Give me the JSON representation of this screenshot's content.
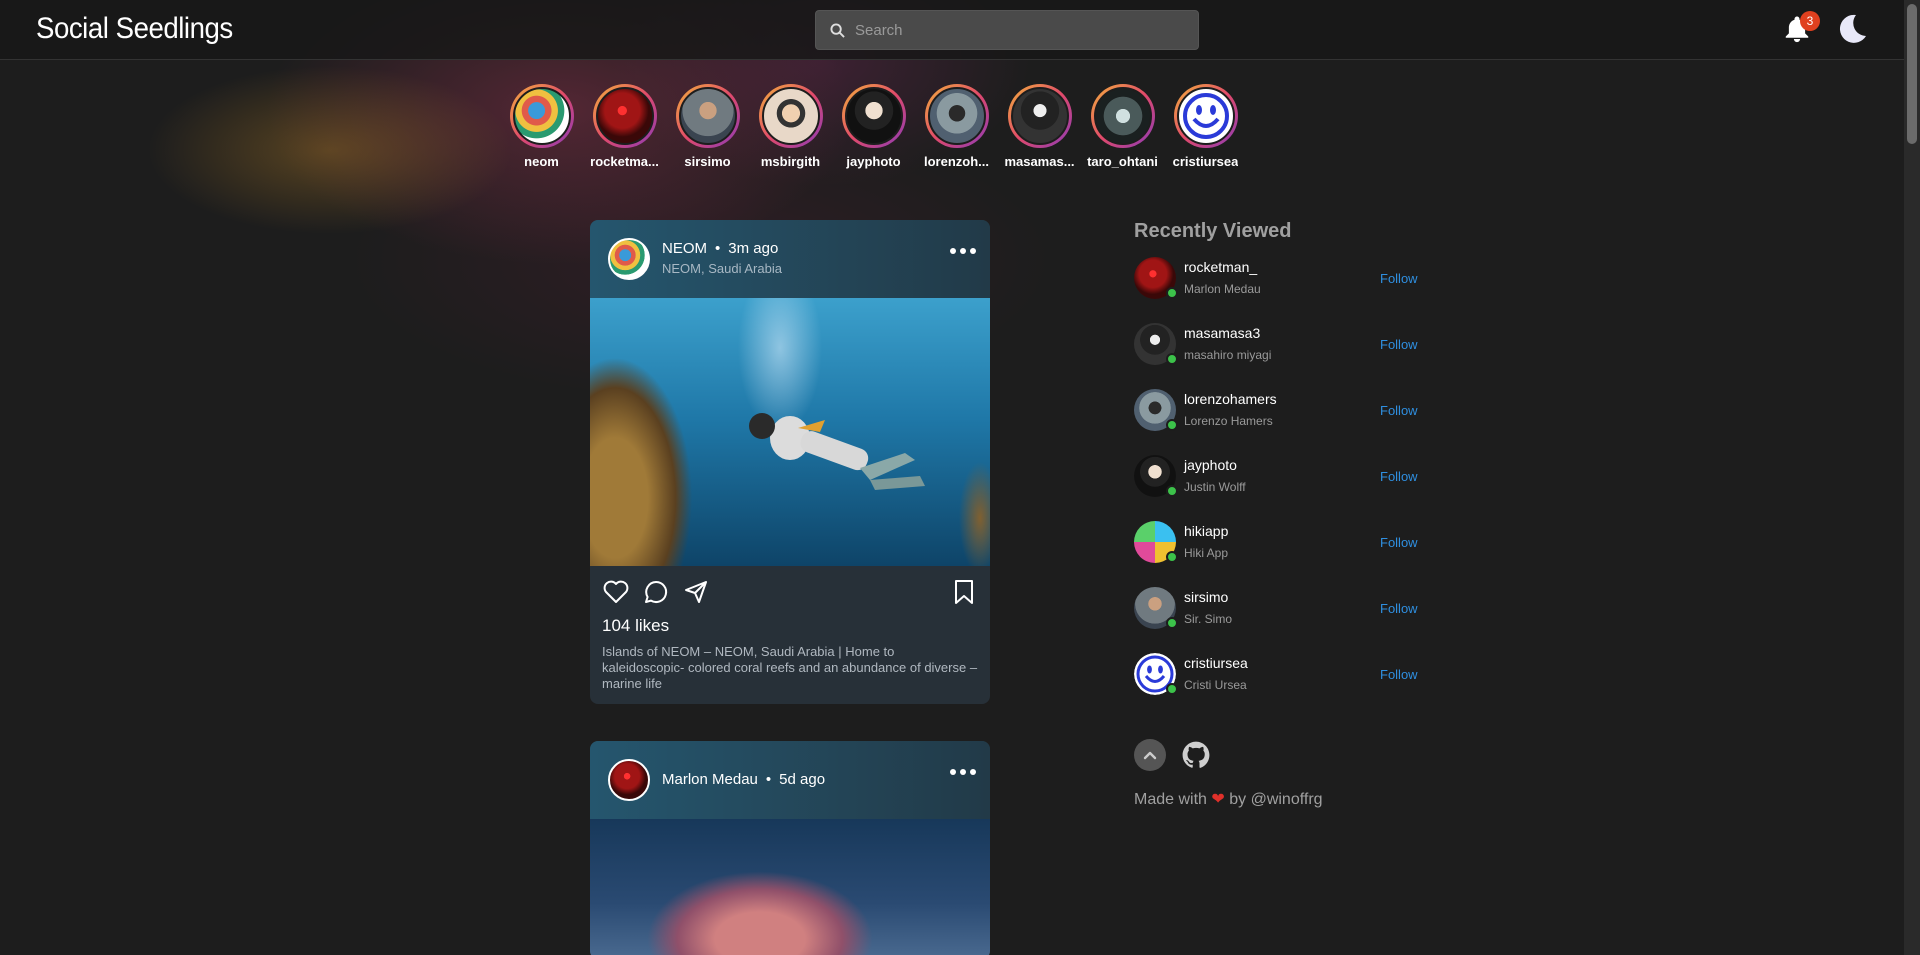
{
  "app": {
    "brand": "Social Seedlings"
  },
  "search": {
    "placeholder": "Search"
  },
  "notifications": {
    "count": "3"
  },
  "stories": [
    {
      "name": "neom",
      "avatar": "neom"
    },
    {
      "name": "rocketma...",
      "avatar": "red"
    },
    {
      "name": "sirsimo",
      "avatar": "grey"
    },
    {
      "name": "msbirgith",
      "avatar": "woman"
    },
    {
      "name": "jayphoto",
      "avatar": "photo"
    },
    {
      "name": "lorenzoh...",
      "avatar": "lorenzo"
    },
    {
      "name": "masamas...",
      "avatar": "masa"
    },
    {
      "name": "taro_ohtani",
      "avatar": "taro"
    },
    {
      "name": "cristiursea",
      "avatar": "smile"
    }
  ],
  "posts": [
    {
      "author": "NEOM",
      "time": "3m ago",
      "location": "NEOM, Saudi Arabia",
      "likes": "104 likes",
      "caption": "Islands of NEOM – NEOM, Saudi Arabia | Home to kaleidoscopic- colored coral reefs and an abundance of diverse –marine life"
    },
    {
      "author": "Marlon Medau",
      "time": "5d ago"
    }
  ],
  "sidebar": {
    "title": "Recently Viewed",
    "follow_label": "Follow",
    "items": [
      {
        "username": "rocketman_",
        "name": "Marlon Medau",
        "avatar": "red"
      },
      {
        "username": "masamasa3",
        "name": "masahiro miyagi",
        "avatar": "masa"
      },
      {
        "username": "lorenzohamers",
        "name": "Lorenzo Hamers",
        "avatar": "lorenzo"
      },
      {
        "username": "jayphoto",
        "name": "Justin Wolff",
        "avatar": "photo"
      },
      {
        "username": "hikiapp",
        "name": "Hiki App",
        "avatar": "hiki"
      },
      {
        "username": "sirsimo",
        "name": "Sir. Simo",
        "avatar": "grey"
      },
      {
        "username": "cristiursea",
        "name": "Cristi Ursea",
        "avatar": "smile"
      }
    ],
    "footer": {
      "made_prefix": "Made with",
      "made_suffix": "by @winoffrg"
    }
  },
  "colors": {
    "accent": "#2f8fe0",
    "online": "#3cc24a",
    "badge": "#e0401f"
  }
}
